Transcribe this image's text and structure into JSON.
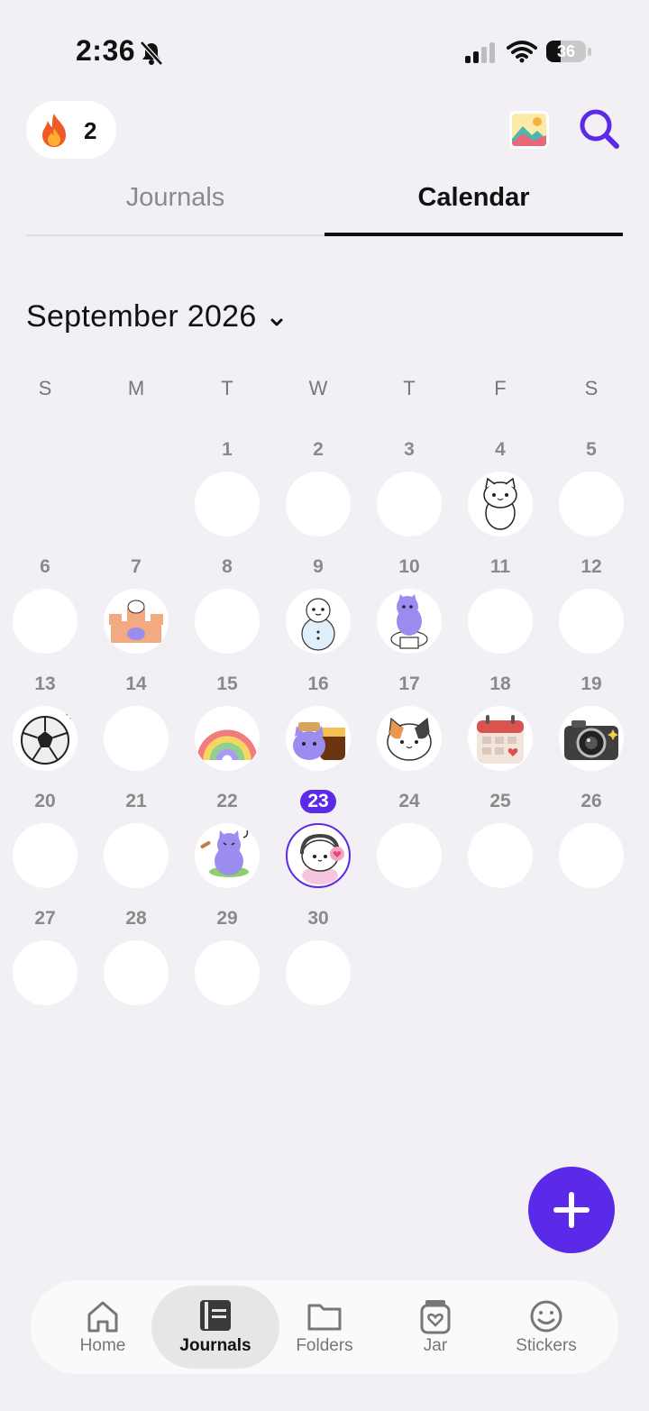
{
  "status_bar": {
    "time": "2:36",
    "battery": "36",
    "battery_level_percent": 36
  },
  "header": {
    "streak_count": "2",
    "streak_icon": "fire-icon",
    "gallery_icon": "gallery-icon",
    "search_icon": "search-icon"
  },
  "tabs": [
    {
      "label": "Journals",
      "active": false
    },
    {
      "label": "Calendar",
      "active": true
    }
  ],
  "calendar": {
    "month_label": "September 2026",
    "weekdays": [
      "S",
      "M",
      "T",
      "W",
      "T",
      "F",
      "S"
    ],
    "today": "23",
    "days": [
      {
        "num": "1",
        "sticker": null
      },
      {
        "num": "2",
        "sticker": null
      },
      {
        "num": "3",
        "sticker": null
      },
      {
        "num": "4",
        "sticker": "white-cat"
      },
      {
        "num": "5",
        "sticker": null
      },
      {
        "num": "6",
        "sticker": null
      },
      {
        "num": "7",
        "sticker": "sandcastle"
      },
      {
        "num": "8",
        "sticker": null
      },
      {
        "num": "9",
        "sticker": "snowman"
      },
      {
        "num": "10",
        "sticker": "cat-on-toilet"
      },
      {
        "num": "11",
        "sticker": null
      },
      {
        "num": "12",
        "sticker": null
      },
      {
        "num": "13",
        "sticker": "soccer-ball"
      },
      {
        "num": "14",
        "sticker": null
      },
      {
        "num": "15",
        "sticker": "rainbow"
      },
      {
        "num": "16",
        "sticker": "cat-with-jar"
      },
      {
        "num": "17",
        "sticker": "calico-cat"
      },
      {
        "num": "18",
        "sticker": "calendar"
      },
      {
        "num": "19",
        "sticker": "camera"
      },
      {
        "num": "20",
        "sticker": null
      },
      {
        "num": "21",
        "sticker": null
      },
      {
        "num": "22",
        "sticker": "dancing-cat"
      },
      {
        "num": "23",
        "sticker": "cat-with-headphones"
      },
      {
        "num": "24",
        "sticker": null
      },
      {
        "num": "25",
        "sticker": null
      },
      {
        "num": "26",
        "sticker": null
      },
      {
        "num": "27",
        "sticker": null
      },
      {
        "num": "28",
        "sticker": null
      },
      {
        "num": "29",
        "sticker": null
      },
      {
        "num": "30",
        "sticker": null
      }
    ]
  },
  "fab": {
    "icon": "plus-icon"
  },
  "bottom_nav": [
    {
      "label": "Home",
      "icon": "home-icon",
      "active": false
    },
    {
      "label": "Journals",
      "icon": "journal-icon",
      "active": true
    },
    {
      "label": "Folders",
      "icon": "folder-icon",
      "active": false
    },
    {
      "label": "Jar",
      "icon": "jar-icon",
      "active": false
    },
    {
      "label": "Stickers",
      "icon": "smiley-icon",
      "active": false
    }
  ],
  "colors": {
    "accent": "#5b2ae8",
    "background": "#f2f0f5",
    "circle": "#ffffff"
  }
}
